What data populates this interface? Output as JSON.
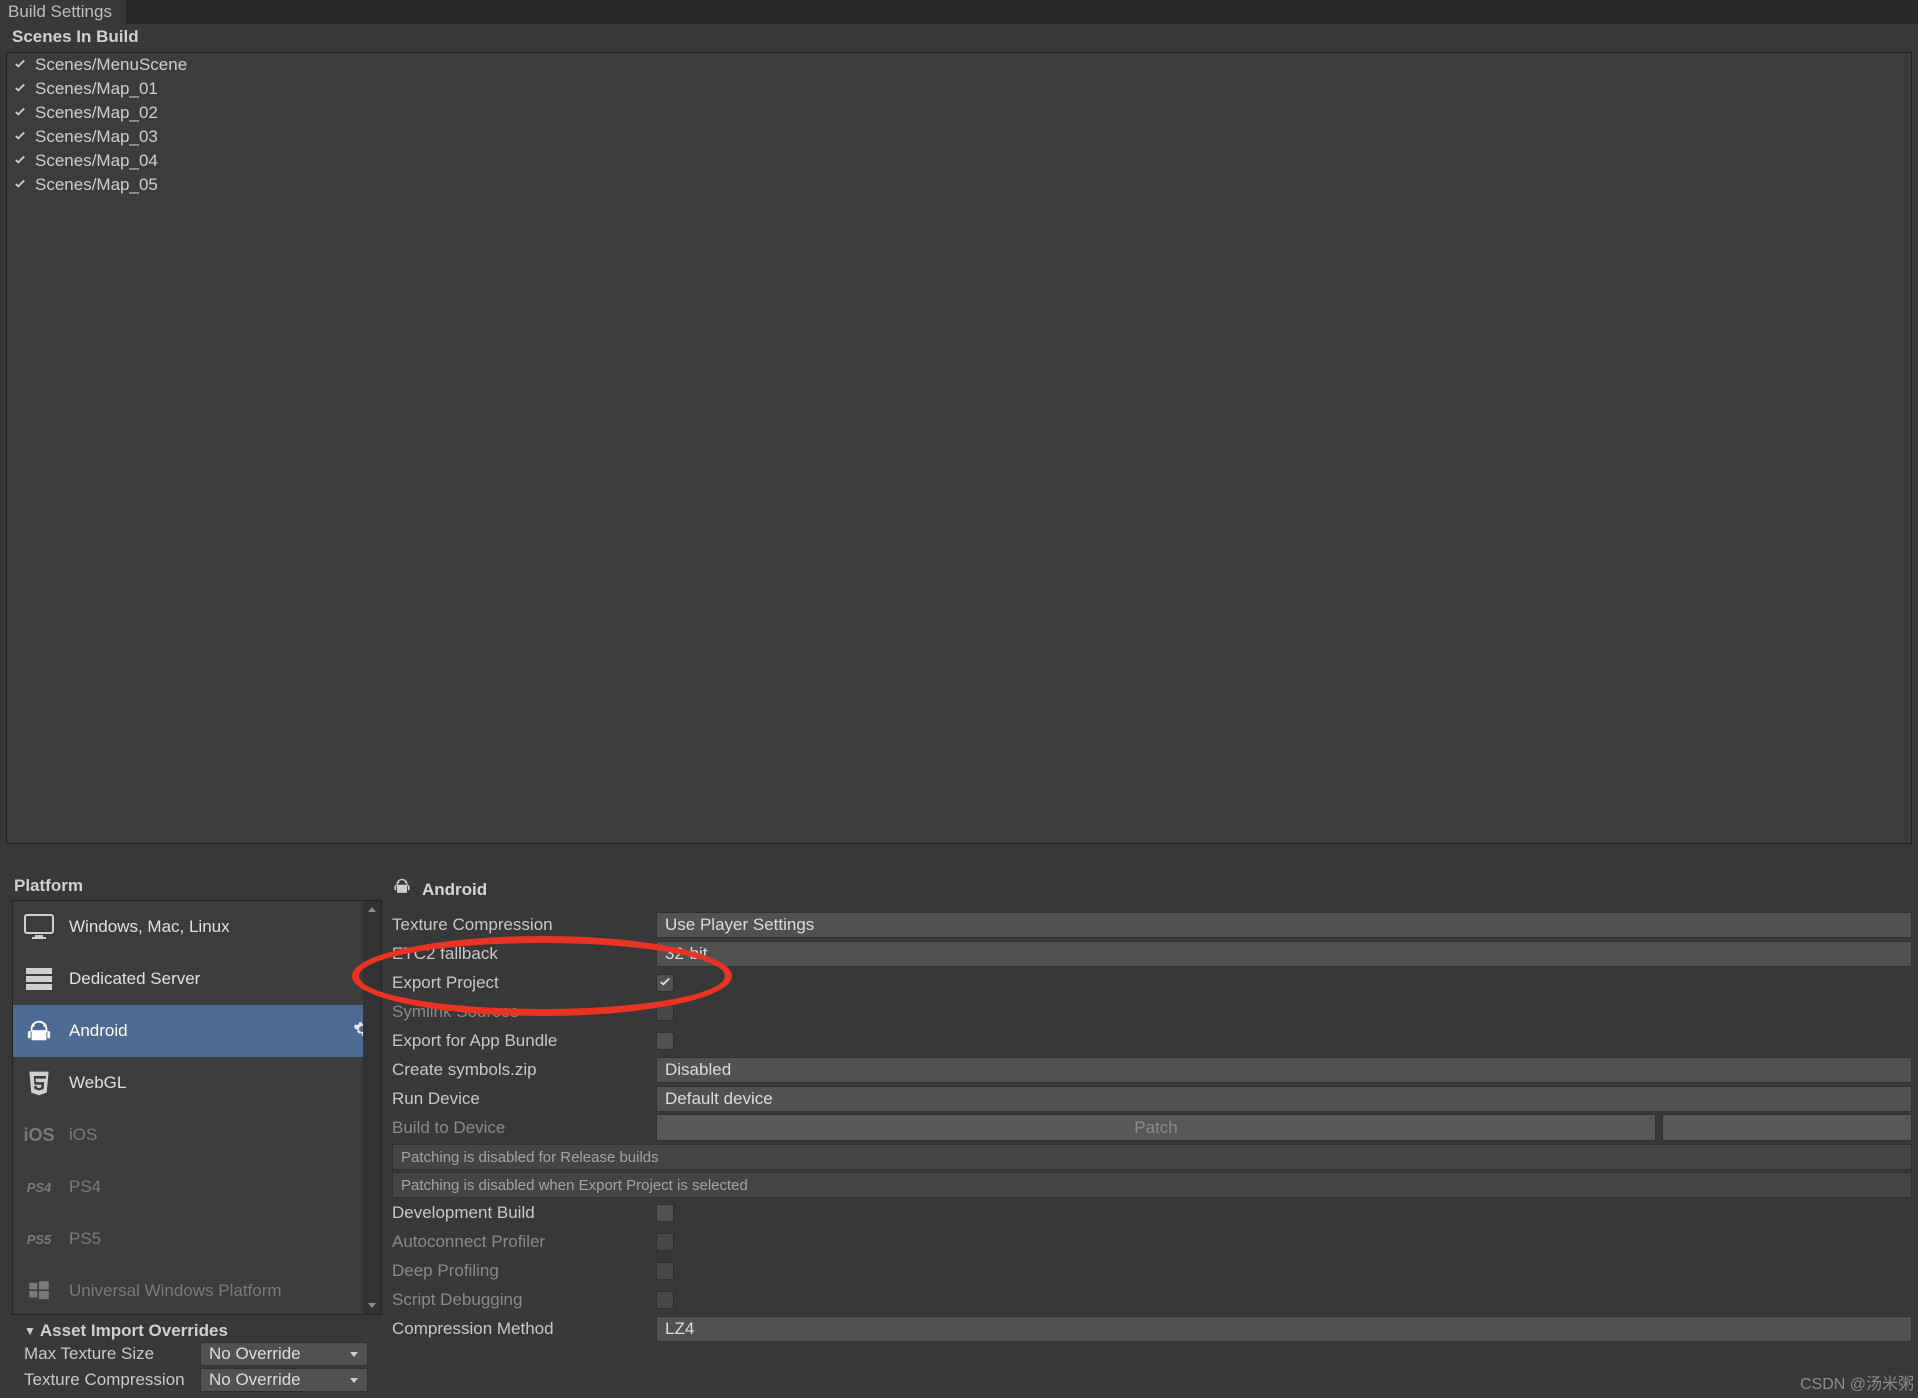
{
  "tab": {
    "title": "Build Settings"
  },
  "scenes": {
    "header": "Scenes In Build",
    "items": [
      "Scenes/MenuScene",
      "Scenes/Map_01",
      "Scenes/Map_02",
      "Scenes/Map_03",
      "Scenes/Map_04",
      "Scenes/Map_05"
    ]
  },
  "platform": {
    "header": "Platform",
    "items": {
      "win": "Windows, Mac, Linux",
      "server": "Dedicated Server",
      "android": "Android",
      "webgl": "WebGL",
      "ios": "iOS",
      "ps4": "PS4",
      "ps5": "PS5",
      "uwp": "Universal Windows Platform"
    }
  },
  "details": {
    "title": "Android",
    "texture_compression": {
      "label": "Texture Compression",
      "value": "Use Player Settings"
    },
    "etc2_fallback": {
      "label": "ETC2 fallback",
      "value": "32-bit"
    },
    "export_project": {
      "label": "Export Project"
    },
    "symlink_sources": {
      "label": "Symlink Sources"
    },
    "export_app_bundle": {
      "label": "Export for App Bundle"
    },
    "create_symbols": {
      "label": "Create symbols.zip",
      "value": "Disabled"
    },
    "run_device": {
      "label": "Run Device",
      "value": "Default device"
    },
    "build_to_device": {
      "label": "Build to Device",
      "patch": "Patch"
    },
    "info1": "Patching is disabled for Release builds",
    "info2": "Patching is disabled when Export Project is selected",
    "dev_build": {
      "label": "Development Build"
    },
    "autoconnect": {
      "label": "Autoconnect Profiler"
    },
    "deep_profiling": {
      "label": "Deep Profiling"
    },
    "script_debug": {
      "label": "Script Debugging"
    },
    "compression_method": {
      "label": "Compression Method",
      "value": "LZ4"
    }
  },
  "overrides": {
    "header": "Asset Import Overrides",
    "max_texture": {
      "label": "Max Texture Size",
      "value": "No Override"
    },
    "texture_comp": {
      "label": "Texture Compression",
      "value": "No Override"
    }
  },
  "watermark": "CSDN @汤米粥"
}
